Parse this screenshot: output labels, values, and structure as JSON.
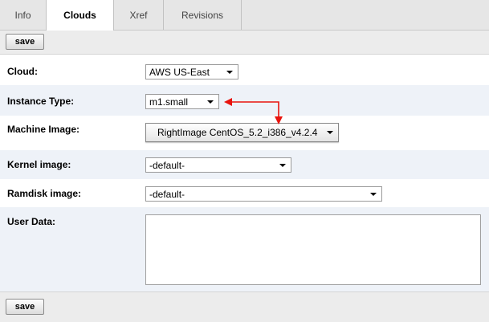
{
  "tabs": [
    {
      "label": "Info",
      "active": false
    },
    {
      "label": "Clouds",
      "active": true
    },
    {
      "label": "Xref",
      "active": false
    },
    {
      "label": "Revisions",
      "active": false
    }
  ],
  "toolbar": {
    "save_label": "save"
  },
  "form": {
    "cloud": {
      "label": "Cloud:",
      "value": "AWS US-East"
    },
    "instance_type": {
      "label": "Instance Type:",
      "value": "m1.small"
    },
    "machine_image": {
      "label": "Machine Image:",
      "value": "RightImage CentOS_5.2_i386_v4.2.4"
    },
    "kernel_image": {
      "label": "Kernel image:",
      "value": "-default-"
    },
    "ramdisk_image": {
      "label": "Ramdisk image:",
      "value": "-default-"
    },
    "user_data": {
      "label": "User Data:",
      "value": ""
    }
  },
  "footer": {
    "save_label": "save"
  },
  "colors": {
    "annotation_arrow": "#e8140e",
    "row_highlight": "#eef2f8"
  }
}
